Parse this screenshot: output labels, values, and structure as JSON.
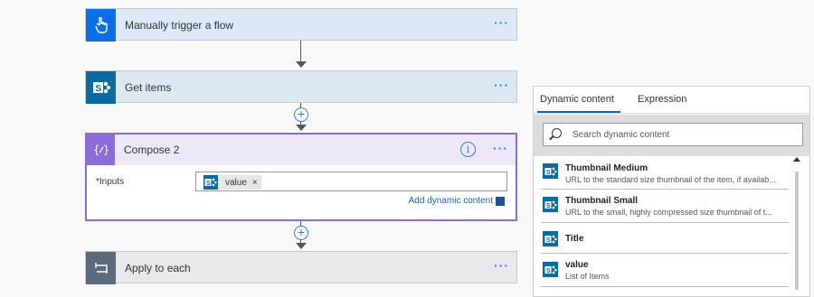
{
  "flow": {
    "trigger": {
      "title": "Manually trigger a flow",
      "more": "···"
    },
    "get_items": {
      "title": "Get items",
      "more": "···"
    },
    "compose": {
      "title": "Compose 2",
      "more": "···",
      "info": "i",
      "inputs_required": "*",
      "inputs_label": "Inputs",
      "token_text": "value",
      "token_remove": "×",
      "add_dynamic": "Add dynamic content"
    },
    "apply": {
      "title": "Apply to each",
      "more": "···"
    },
    "plus": "+"
  },
  "panel": {
    "tabs": [
      "Dynamic content",
      "Expression"
    ],
    "search_placeholder": "Search dynamic content",
    "items": [
      {
        "title": "Thumbnail Medium",
        "desc": "URL to the standard size thumbnail of the item, if availab..."
      },
      {
        "title": "Thumbnail Small",
        "desc": "URL to the small, highly compressed size thumbnail of t..."
      },
      {
        "title": "Title",
        "desc": ""
      },
      {
        "title": "value",
        "desc": "List of Items"
      }
    ]
  },
  "colors": {
    "trigger_accent": "#0a6ee8",
    "sharepoint_accent": "#0b6aa2",
    "compose_accent": "#8c6cd8",
    "apply_accent": "#5b6b7c",
    "link": "#1a5fb4"
  },
  "icons": {
    "trigger": "hand-pointer-icon",
    "sharepoint": "sharepoint-icon",
    "compose": "curly-braces-icon",
    "apply": "loop-icon",
    "search": "search-icon"
  }
}
